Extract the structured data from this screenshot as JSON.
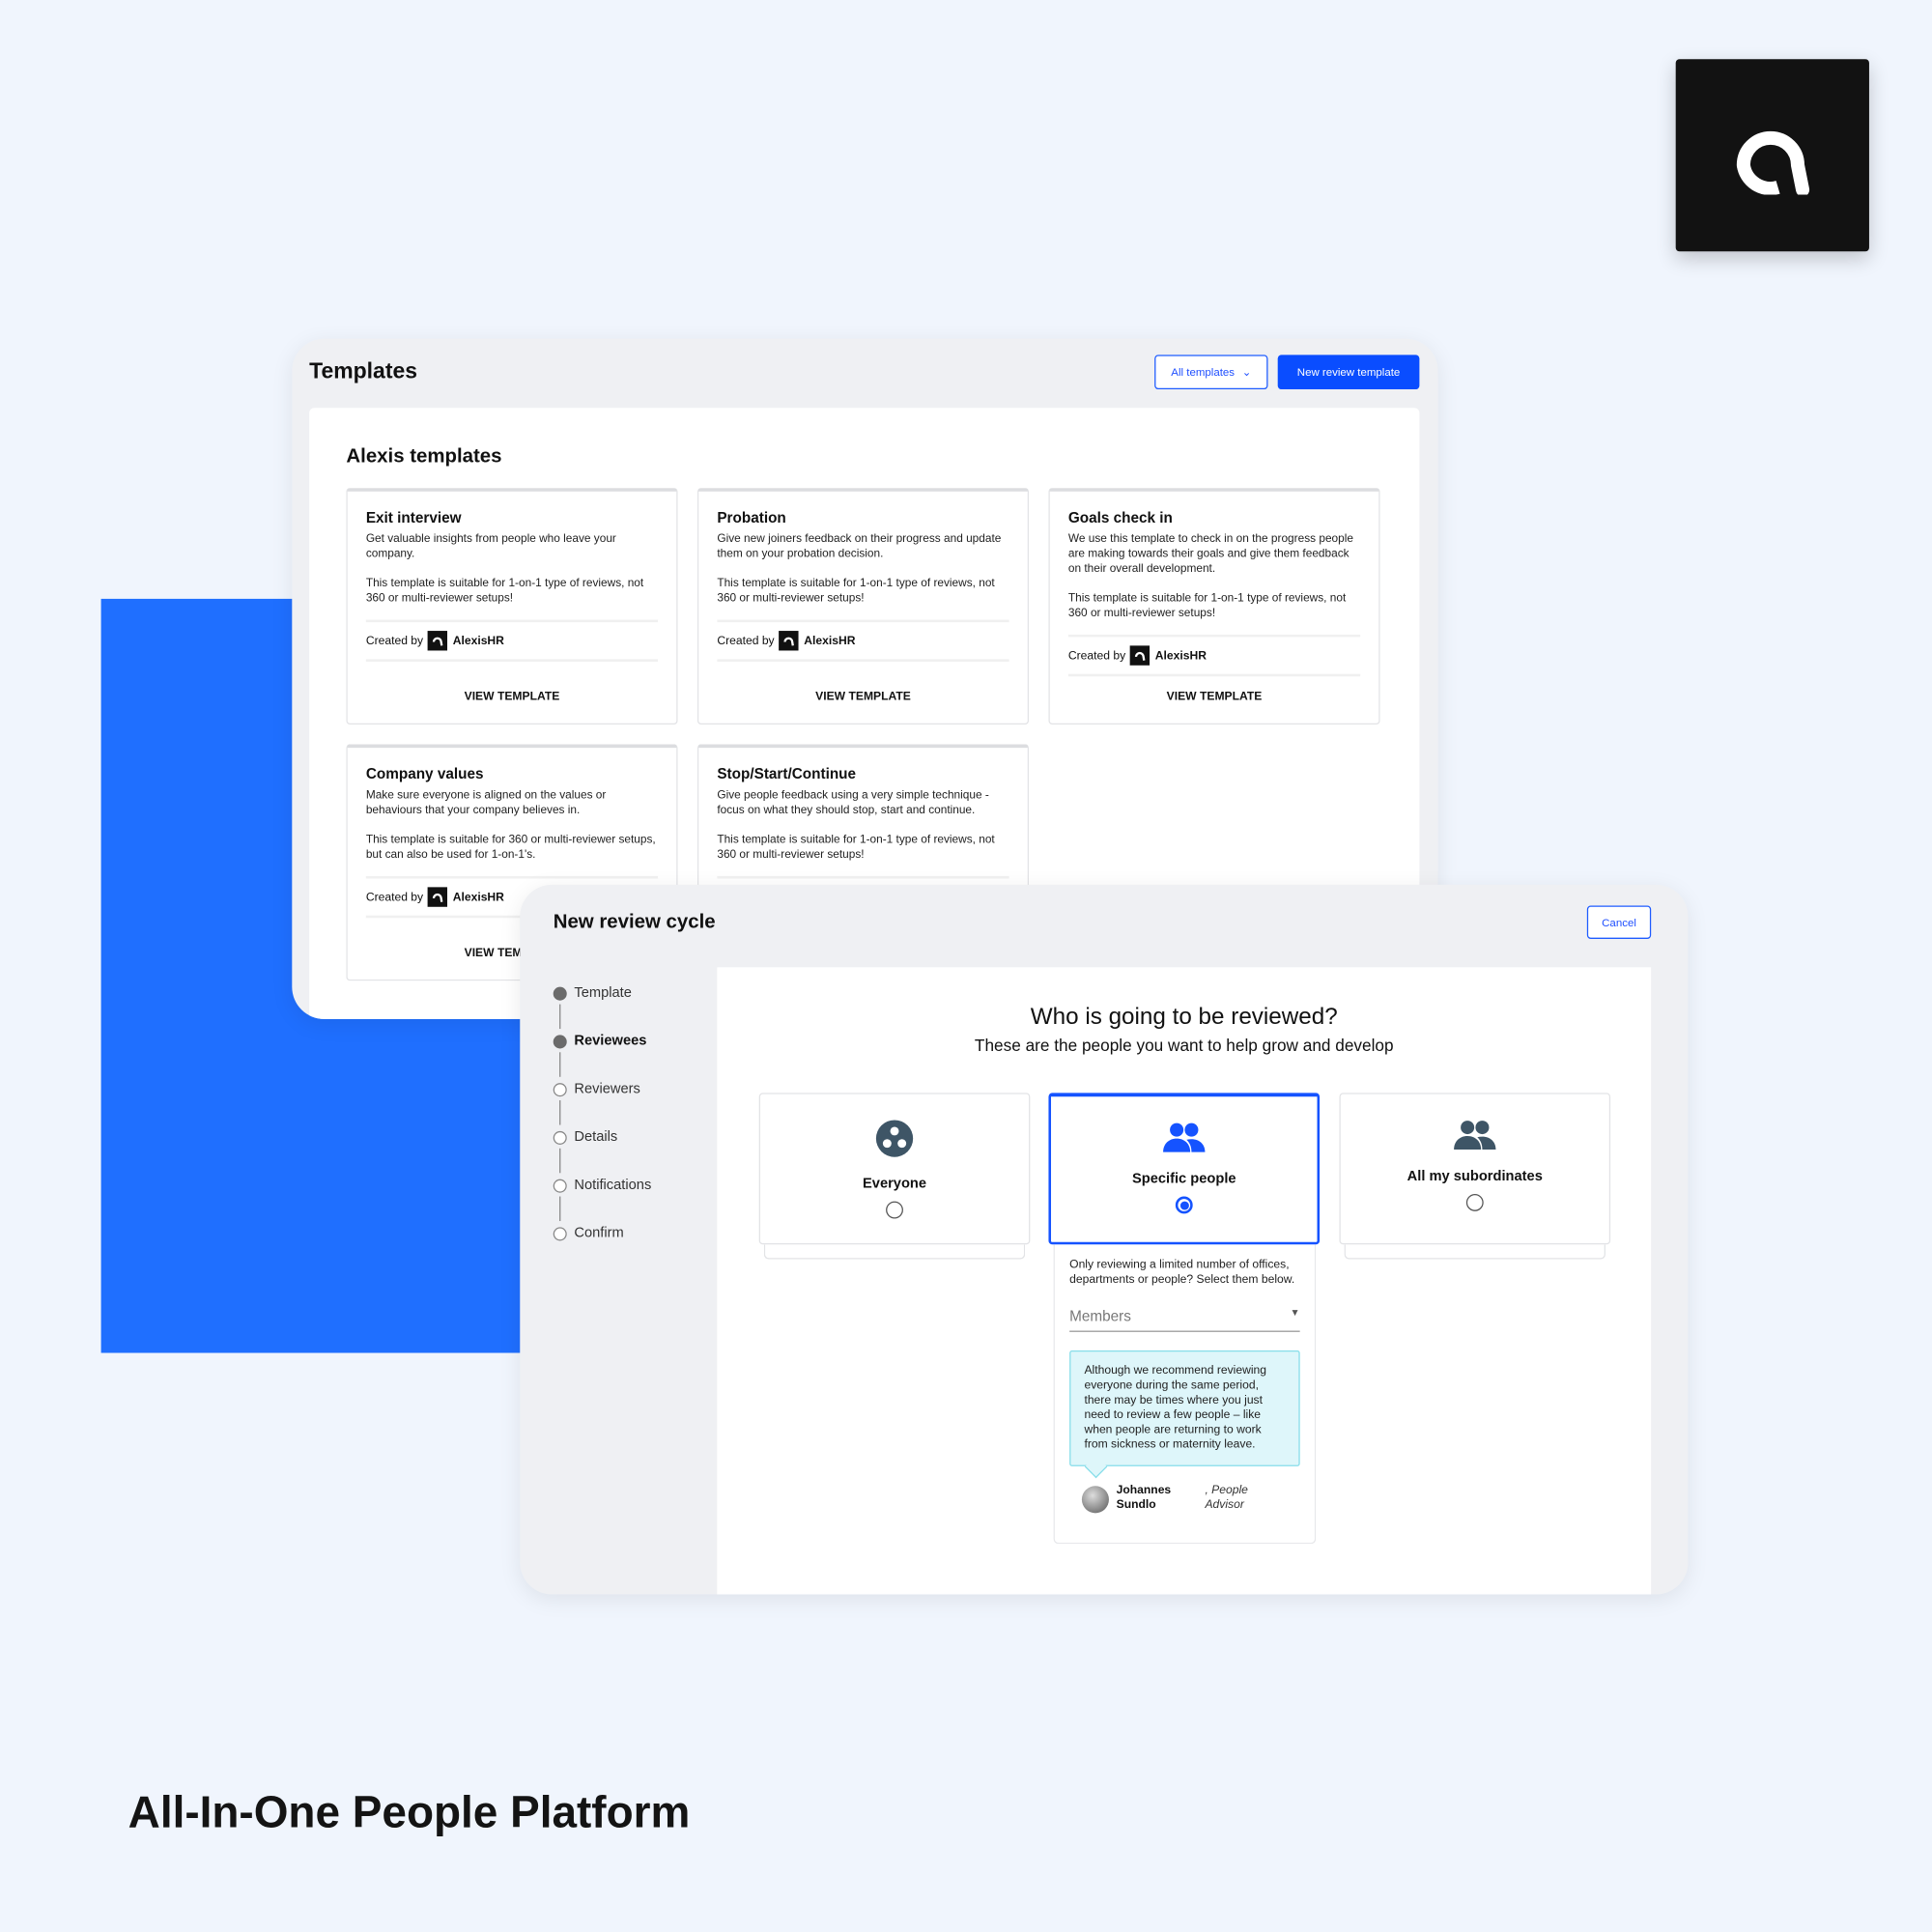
{
  "brand": {
    "logo_icon": "alexis-a-logo",
    "accent": "#1f6fff",
    "tagline": "All-In-One People Platform"
  },
  "templates": {
    "title": "Templates",
    "filter_label": "All templates",
    "new_button": "New review template",
    "section_title": "Alexis templates",
    "created_by_label": "Created by",
    "creator": "AlexisHR",
    "view_label": "VIEW TEMPLATE",
    "cards": [
      {
        "title": "Exit interview",
        "desc": "Get valuable insights from people who leave your company.",
        "note": "This template is suitable for 1-on-1 type of reviews, not 360 or multi-reviewer setups!"
      },
      {
        "title": "Probation",
        "desc": "Give new joiners feedback on their progress and update them on your probation decision.",
        "note": "This template is suitable for 1-on-1 type of reviews, not 360 or multi-reviewer setups!"
      },
      {
        "title": "Goals check in",
        "desc": "We use this template to check in on the progress people are making towards their goals and give them feedback on their overall development.",
        "note": "This template is suitable for 1-on-1 type of reviews, not 360 or multi-reviewer setups!"
      },
      {
        "title": "Company values",
        "desc": "Make sure everyone is aligned on the values or behaviours that your company believes in.",
        "note": "This template is suitable for 360 or multi-reviewer setups, but can also be used for 1-on-1's."
      },
      {
        "title": "Stop/Start/Continue",
        "desc": "Give people feedback using a very simple technique - focus on what they should stop, start and continue.",
        "note": "This template is suitable for 1-on-1 type of reviews, not 360 or multi-reviewer setups!"
      }
    ]
  },
  "review": {
    "title": "New review cycle",
    "cancel": "Cancel",
    "steps": [
      {
        "label": "Template",
        "done": true
      },
      {
        "label": "Reviewees",
        "done": true,
        "current": true
      },
      {
        "label": "Reviewers",
        "done": false
      },
      {
        "label": "Details",
        "done": false
      },
      {
        "label": "Notifications",
        "done": false
      },
      {
        "label": "Confirm",
        "done": false
      }
    ],
    "heading": "Who is going to be reviewed?",
    "subheading": "These are the people you want to help grow and develop",
    "options": [
      {
        "label": "Everyone",
        "icon": "group-circle-icon",
        "selected": false
      },
      {
        "label": "Specific people",
        "icon": "people-icon",
        "selected": true
      },
      {
        "label": "All my subordinates",
        "icon": "people-icon",
        "selected": false
      }
    ],
    "specific_desc": "Only reviewing a limited number of offices, departments or people? Select them below.",
    "members_placeholder": "Members",
    "info": "Although we recommend reviewing everyone during the same period, there may be times where you just need to review a few people – like when people are returning to work from sickness or maternity leave.",
    "advisor_name": "Johannes Sundlo",
    "advisor_role": ", People Advisor"
  }
}
